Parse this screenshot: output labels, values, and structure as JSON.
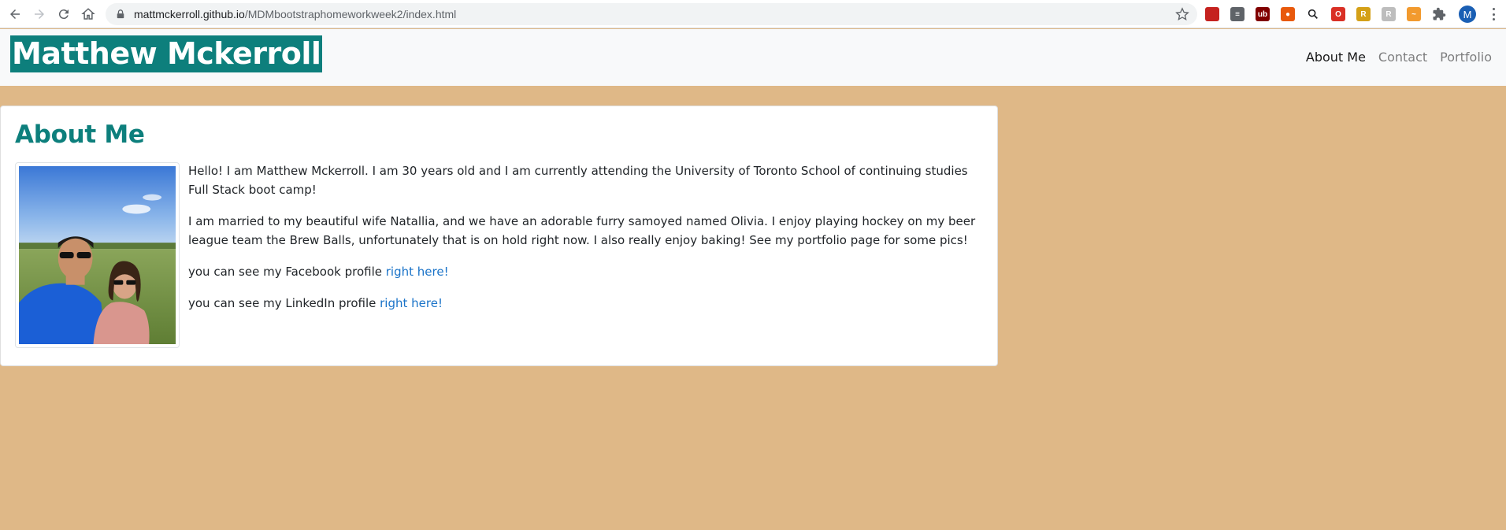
{
  "browser": {
    "url_host": "mattmckerroll.github.io",
    "url_path": "/MDMbootstraphomeworkweek2/index.html",
    "profile_initial": "M",
    "extensions": [
      {
        "icon": "bookmark-extension-icon",
        "color": "#c5221f",
        "glyph": ""
      },
      {
        "icon": "reader-extension-icon",
        "color": "#5f6368",
        "glyph": "≡"
      },
      {
        "icon": "ublock-extension-icon",
        "color": "#800000",
        "glyph": "ub"
      },
      {
        "icon": "privacy-extension-icon",
        "color": "#e8590c",
        "glyph": "●"
      },
      {
        "icon": "search-extension-icon",
        "color": "#202124",
        "glyph": ""
      },
      {
        "icon": "oc-extension-icon",
        "color": "#d93025",
        "glyph": "O"
      },
      {
        "icon": "honey-extension-icon",
        "color": "#d4a017",
        "glyph": "R"
      },
      {
        "icon": "grey-extension-icon",
        "color": "#bdbdbd",
        "glyph": "R"
      },
      {
        "icon": "wave-extension-icon",
        "color": "#f29a2e",
        "glyph": "~"
      },
      {
        "icon": "puzzle-extensions-icon",
        "color": "#ffffff",
        "glyph": ""
      }
    ]
  },
  "site": {
    "brand": "Matthew Mckerroll",
    "nav": [
      {
        "label": "About Me",
        "active": true
      },
      {
        "label": "Contact",
        "active": false
      },
      {
        "label": "Portfolio",
        "active": false
      }
    ]
  },
  "about": {
    "title": "About Me",
    "photo_alt": "selfie-photo",
    "paragraph_1": "Hello! I am Matthew Mckerroll. I am 30 years old and I am currently attending the University of Toronto School of continuing studies Full Stack boot camp!",
    "paragraph_2": "I am married to my beautiful wife Natallia, and we have an adorable furry samoyed named Olivia. I enjoy playing hockey on my beer league team the Brew Balls, unfortunately that is on hold right now. I also really enjoy baking! See my portfolio page for some pics!",
    "facebook_prefix": "you can see my Facebook profile ",
    "facebook_link": "right here!",
    "linkedin_prefix": "you can see my LinkedIn profile ",
    "linkedin_link": "right here!"
  },
  "colors": {
    "page_bg": "#dfb887",
    "brand_bg": "#0d7f7c",
    "title": "#0d7f7c",
    "link": "#1a73c8"
  }
}
